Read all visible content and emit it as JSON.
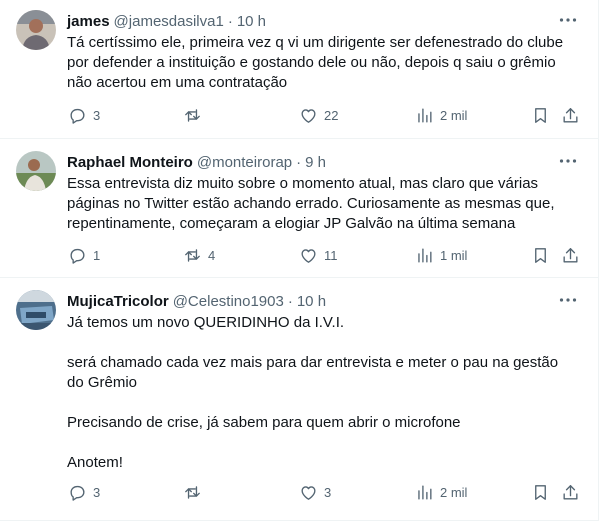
{
  "tweets": [
    {
      "name": "james",
      "handle": "@jamesdasilva1",
      "dot": "·",
      "time": "10 h",
      "lines": [
        "Tá certíssimo ele, primeira vez q vi um dirigente ser defenestrado do clube",
        "por defender a instituição e gostando dele ou não, depois q saiu o grêmio",
        "não acertou em uma contratação"
      ],
      "replies": "3",
      "retweets": "",
      "likes": "22",
      "views": "2 mil"
    },
    {
      "name": "Raphael Monteiro",
      "handle": "@monteirorap",
      "dot": "·",
      "time": "9 h",
      "lines": [
        "Essa entrevista diz muito sobre o momento atual, mas claro que várias",
        "páginas no Twitter estão achando errado. Curiosamente as mesmas que,",
        "repentinamente, começaram a elogiar JP Galvão na última semana"
      ],
      "replies": "1",
      "retweets": "4",
      "likes": "11",
      "views": "1 mil"
    },
    {
      "name": "MujicaTricolor",
      "handle": "@Celestino1903",
      "dot": "·",
      "time": "10 h",
      "lines": [
        "Já temos um novo QUERIDINHO da I.V.I.",
        "",
        "será chamado cada vez mais para dar entrevista e meter o pau na gestão",
        "do Grêmio",
        "",
        "Precisando de crise, já sabem para quem abrir o microfone",
        "",
        "Anotem!"
      ],
      "replies": "3",
      "retweets": "",
      "likes": "3",
      "views": "2 mil"
    }
  ],
  "icons": {
    "reply": "reply-icon",
    "retweet": "retweet-icon",
    "like": "heart-icon",
    "views": "views-chart-icon",
    "bookmark": "bookmark-icon",
    "share": "share-icon",
    "more": "more-horizontal-icon"
  },
  "colors": {
    "text": "#0f1419",
    "secondary": "#536471",
    "divider": "#eff3f4"
  }
}
